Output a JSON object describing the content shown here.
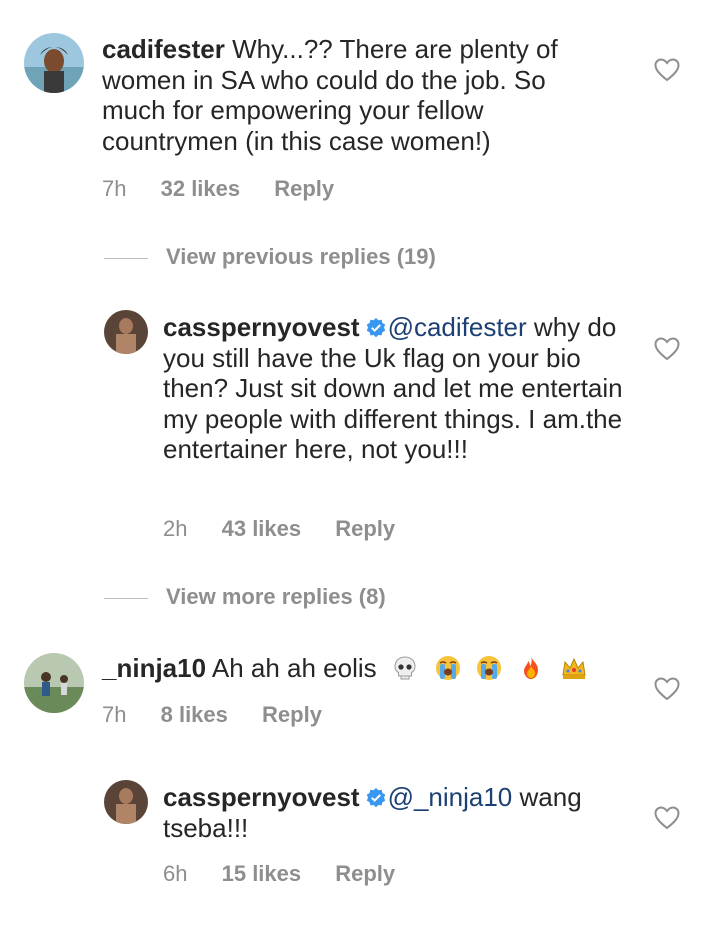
{
  "comments": [
    {
      "username": "cadifester",
      "text": "Why...?? There are plenty of women in SA who could do the job.  So much for empowering your fellow countrymen (in this case women!)",
      "time": "7h",
      "likes": "32 likes",
      "reply": "Reply"
    },
    {
      "username": "casspernyovest",
      "mention": "@cadifester",
      "text": " why do you still have the Uk flag on your bio then?  Just sit down and let me entertain my people with different things. I am.the entertainer here, not you!!!",
      "time": "2h",
      "likes": "43 likes",
      "reply": "Reply"
    },
    {
      "username": "_ninja10",
      "text": "Ah ah ah eolis",
      "emojis": [
        "skull-emoji",
        "crying-emoji",
        "crying-emoji",
        "fire-emoji",
        "crown-emoji"
      ],
      "time": "7h",
      "likes": "8 likes",
      "reply": "Reply"
    },
    {
      "username": "casspernyovest",
      "mention": "@_ninja10",
      "text": " wang tseba!!!",
      "time": "6h",
      "likes": "15 likes",
      "reply": "Reply"
    }
  ],
  "view_previous_replies": "View previous replies (19)",
  "view_more_replies": "View more replies (8)",
  "colors": {
    "text": "#262626",
    "meta": "#8e8e8e",
    "mention": "#1c3f74",
    "verified": "#3897f0"
  }
}
